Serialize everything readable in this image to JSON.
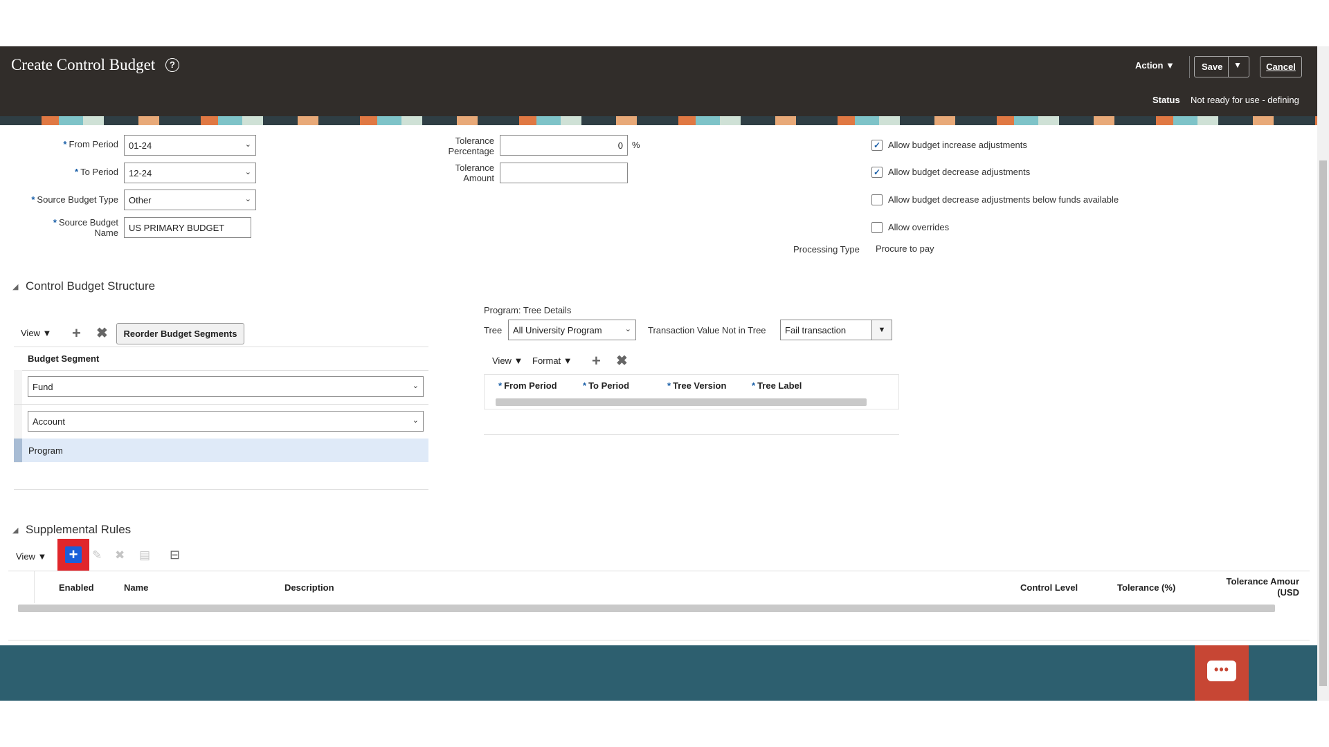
{
  "header": {
    "title": "Create Control Budget",
    "help_icon": "?",
    "action_label": "Action ▼",
    "save_label": "Save",
    "save_menu_icon": "▼",
    "cancel_label": "Cancel",
    "status_label": "Status",
    "status_value": "Not ready for use - defining"
  },
  "form": {
    "from_period_label": "From Period",
    "from_period_value": "01-24",
    "to_period_label": "To Period",
    "to_period_value": "12-24",
    "source_budget_type_label": "Source Budget Type",
    "source_budget_type_value": "Other",
    "source_budget_name_label_1": "Source Budget",
    "source_budget_name_label_2": "Name",
    "source_budget_name_value": "US PRIMARY BUDGET",
    "required_mark": "*",
    "tolerance_pct_label_1": "Tolerance",
    "tolerance_pct_label_2": "Percentage",
    "tolerance_pct_value": "0",
    "percent_sign": "%",
    "tolerance_amt_label_1": "Tolerance",
    "tolerance_amt_label_2": "Amount",
    "tolerance_amt_value": "",
    "options": [
      {
        "label": "Allow budget increase adjustments",
        "checked": true
      },
      {
        "label": "Allow budget decrease adjustments",
        "checked": true
      },
      {
        "label": "Allow budget decrease adjustments below funds available",
        "checked": false
      },
      {
        "label": "Allow overrides",
        "checked": false
      }
    ],
    "check_mark": "✓",
    "processing_type_label": "Processing Type",
    "processing_type_value": "Procure to pay"
  },
  "structure": {
    "title": "Control Budget Structure",
    "view_label": "View ▼",
    "reorder_label": "Reorder Budget Segments",
    "column_header": "Budget Segment",
    "segments": [
      "Fund",
      "Account",
      "Program"
    ],
    "tree_details_title": "Program: Tree Details",
    "tree_label": "Tree",
    "tree_value": "All University Program",
    "txn_not_in_tree_label": "Transaction Value Not in Tree",
    "txn_not_in_tree_value": "Fail transaction",
    "format_label": "Format ▼",
    "tree_columns": [
      "From Period",
      "To Period",
      "Tree Version",
      "Tree Label"
    ]
  },
  "supplemental": {
    "title": "Supplemental Rules",
    "view_label": "View ▼",
    "columns": [
      "Enabled",
      "Name",
      "Description",
      "Control Level",
      "Tolerance (%)",
      "Tolerance Amour",
      "(USD"
    ]
  },
  "icons": {
    "plus": "+",
    "close": "✖",
    "chevron": "⌄",
    "collapse": "◢",
    "chat": "•••",
    "edit": "✎",
    "copy": "▤",
    "filter": "⊟"
  },
  "colors": {
    "header_bg": "#312d2a",
    "footer_bg": "#2d5f6f",
    "chat_bg": "#c74634",
    "highlight_red": "#e0262b",
    "add_blue": "#1a5fd9",
    "selected_row": "#dfeaf8"
  }
}
